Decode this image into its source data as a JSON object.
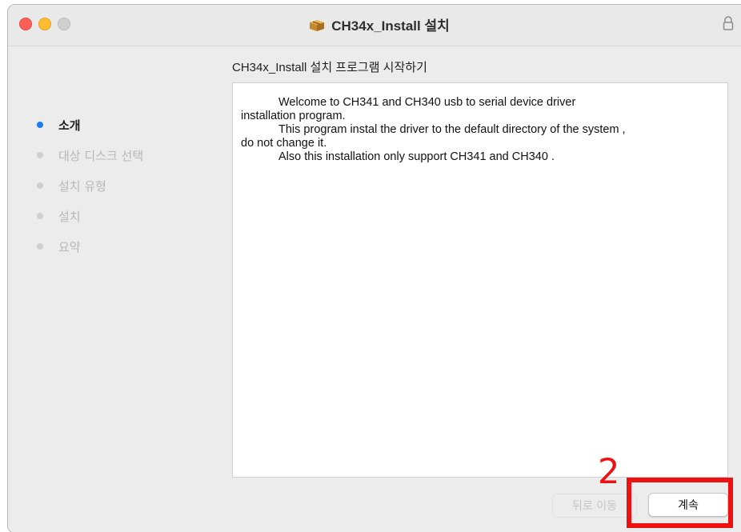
{
  "window": {
    "title": "CH34x_Install 설치",
    "icons": {
      "app": "package-icon",
      "lock": "lock-icon"
    }
  },
  "heading": "CH34x_Install 설치 프로그램 시작하기",
  "steps": [
    {
      "label": "소개",
      "active": true
    },
    {
      "label": "대상 디스크 선택",
      "active": false
    },
    {
      "label": "설치 유형",
      "active": false
    },
    {
      "label": "설치",
      "active": false
    },
    {
      "label": "요약",
      "active": false
    }
  ],
  "content": {
    "lines": [
      "Welcome to CH341 and CH340 usb to serial device driver",
      "installation program.",
      "This program instal the driver to the default directory of the system ,",
      "do not change it.",
      "Also this installation only support CH341 and CH340 ."
    ]
  },
  "buttons": {
    "back": "뒤로 이동",
    "continue": "계속"
  },
  "annotation": {
    "number": "2",
    "color": "#ee1111"
  },
  "colors": {
    "accent": "#1b7cf1",
    "close": "#ff5f57",
    "minimize": "#febc2e"
  }
}
